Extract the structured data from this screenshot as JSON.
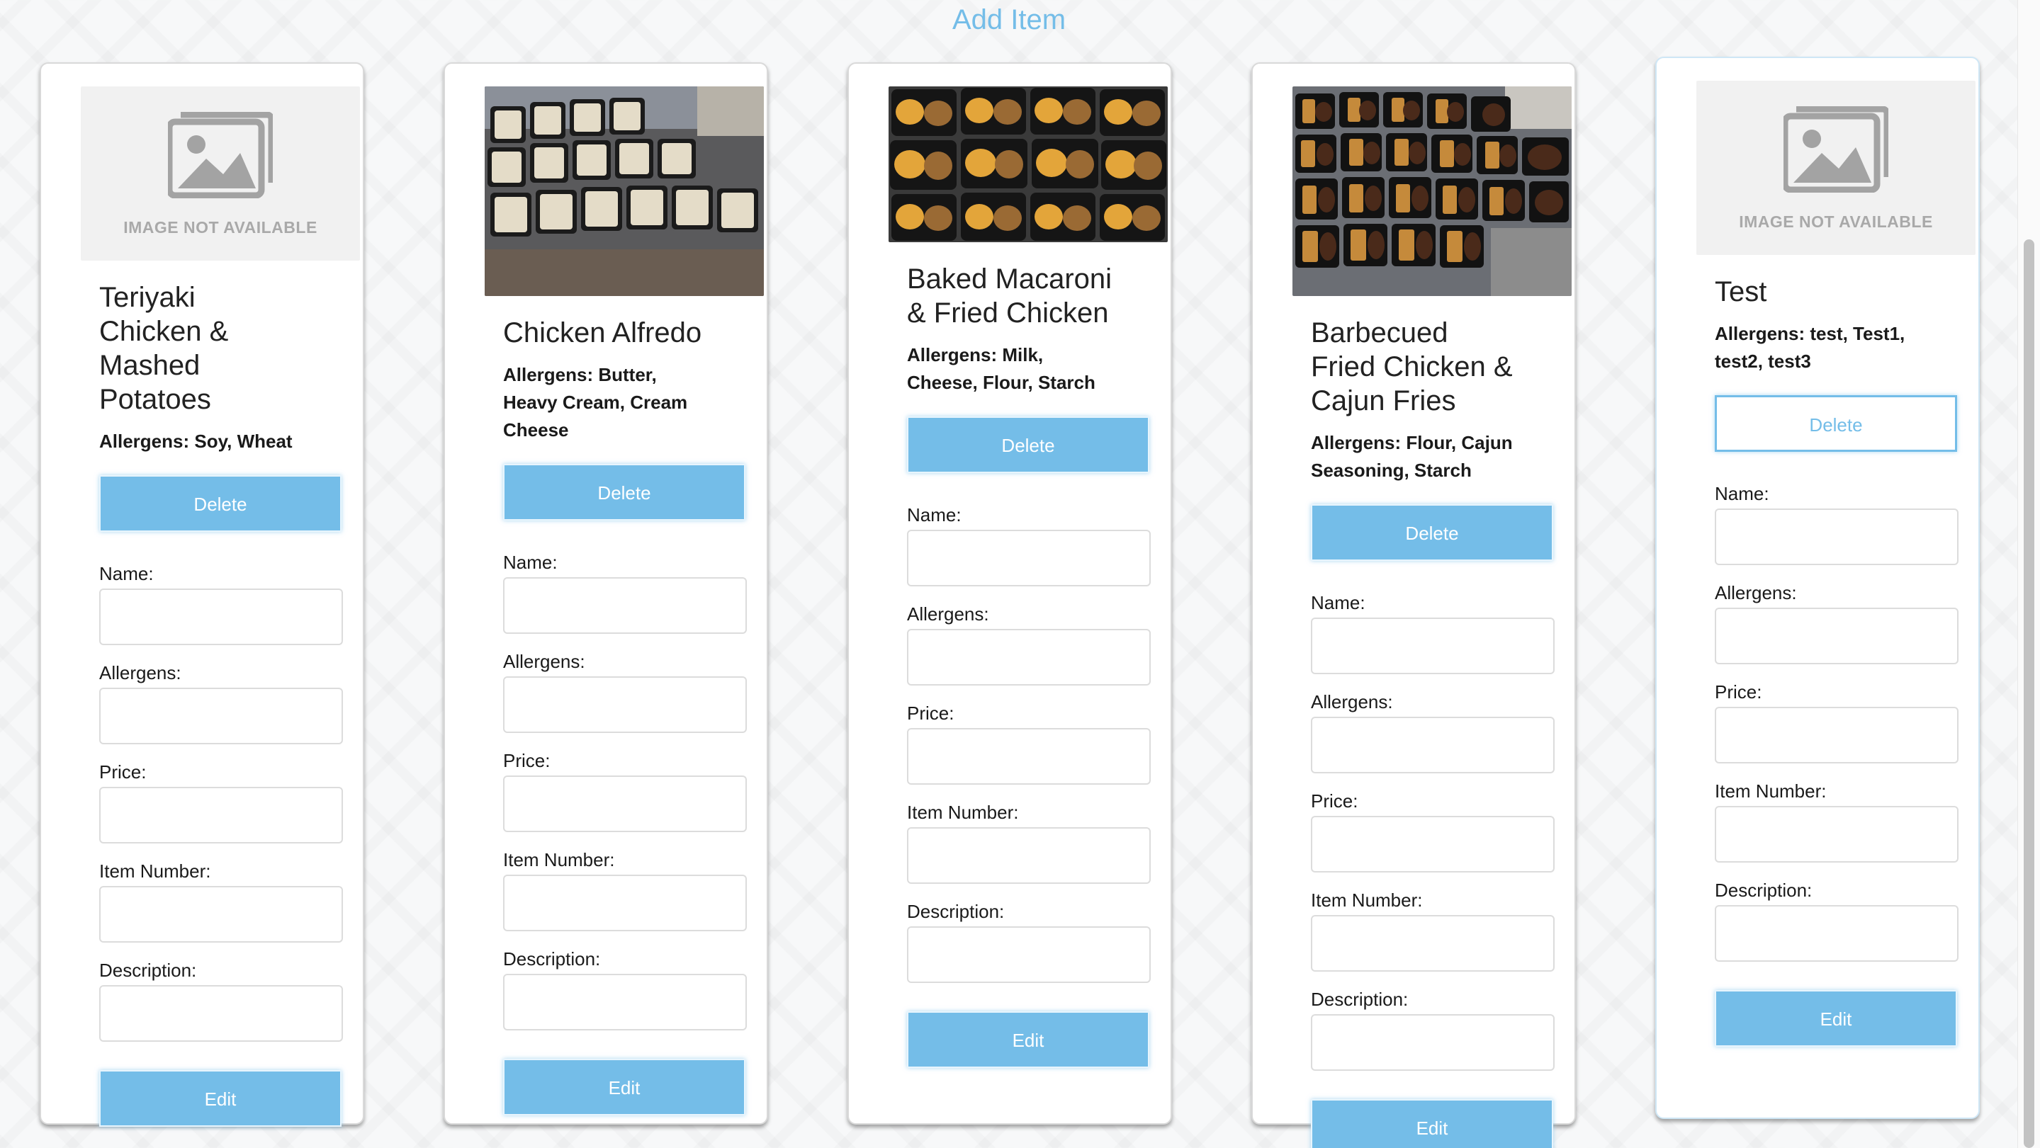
{
  "header": {
    "add_item_label": "Add Item"
  },
  "labels": {
    "image_not_available": "IMAGE NOT AVAILABLE",
    "delete": "Delete",
    "edit": "Edit",
    "name": "Name:",
    "allergens": "Allergens:",
    "price": "Price:",
    "item_number": "Item Number:",
    "description": "Description:"
  },
  "items": [
    {
      "title": "Teriyaki Chicken & Mashed Potatoes",
      "allergens": "Allergens: Soy, Wheat",
      "image": "placeholder-icon",
      "delete_style": "filled"
    },
    {
      "title": "Chicken Alfredo",
      "allergens": "Allergens: Butter, Heavy Cream, Cream Cheese",
      "image": "photo-pasta-containers",
      "delete_style": "filled"
    },
    {
      "title": "Baked Macaroni & Fried Chicken",
      "allergens": "Allergens: Milk, Cheese, Flour, Starch",
      "image": "photo-mac-and-chicken-containers",
      "delete_style": "filled"
    },
    {
      "title": "Barbecued Fried Chicken & Cajun Fries",
      "allergens": "Allergens: Flour, Cajun Seasoning, Starch",
      "image": "photo-bbq-chicken-fries-containers",
      "delete_style": "filled"
    },
    {
      "title": "Test",
      "allergens": "Allergens: test, Test1, test2, test3",
      "image": "placeholder-icon",
      "delete_style": "outline"
    }
  ],
  "colors": {
    "accent": "#74bde8",
    "placeholder_bg": "#f1f1f1",
    "placeholder_text": "#a9a9a9"
  }
}
